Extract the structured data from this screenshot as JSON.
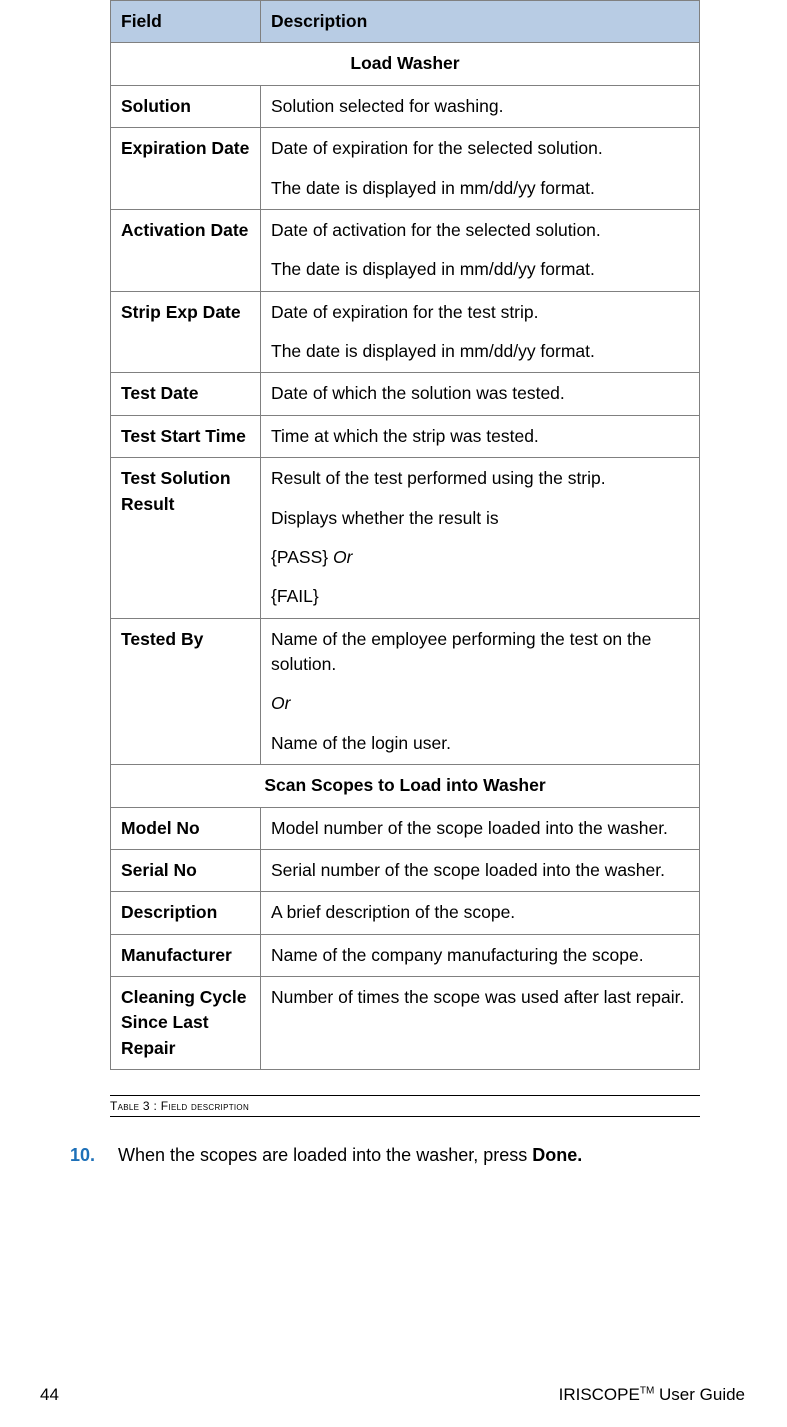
{
  "table": {
    "headers": {
      "field": "Field",
      "description": "Description"
    },
    "section1": "Load Washer",
    "rows1": [
      {
        "field": "Solution",
        "desc": [
          "Solution selected for washing."
        ]
      },
      {
        "field": "Expiration Date",
        "desc": [
          "Date of expiration for the selected solution.",
          "The date is displayed in mm/dd/yy format."
        ]
      },
      {
        "field": "Activation Date",
        "desc": [
          "Date of activation for the selected solution.",
          "The date is displayed in mm/dd/yy format."
        ]
      },
      {
        "field": "Strip Exp Date",
        "desc": [
          "Date of expiration for the test strip.",
          "The date is displayed in mm/dd/yy format."
        ]
      },
      {
        "field": "Test Date",
        "desc": [
          "Date of which  the solution was tested."
        ]
      },
      {
        "field": "Test Start Time",
        "desc": [
          "Time at which the strip was tested."
        ]
      },
      {
        "field": "Test Solution Result",
        "desc_html": "test_solution_result"
      },
      {
        "field": "Tested By",
        "desc_html": "tested_by"
      }
    ],
    "section2": "Scan Scopes to Load into Washer",
    "rows2": [
      {
        "field": "Model No",
        "desc": [
          "Model number of the scope loaded into the washer."
        ]
      },
      {
        "field": "Serial No",
        "desc": [
          "Serial number of the scope loaded into the washer."
        ]
      },
      {
        "field": "Description",
        "desc": [
          "A brief description of the scope."
        ]
      },
      {
        "field": "Manufacturer",
        "desc": [
          "Name of the company manufacturing the scope."
        ]
      },
      {
        "field": "Cleaning Cycle Since Last Repair",
        "desc": [
          "Number of times the scope was used after last repair."
        ]
      }
    ],
    "special": {
      "test_solution_result": {
        "p1": "Result of the test performed using the strip.",
        "p2": "Displays whether the result is",
        "p3_pre": "{PASS} ",
        "p3_it": "Or",
        "p4": "{FAIL}"
      },
      "tested_by": {
        "p1": "Name of the employee performing the test on the solution.",
        "p2_it": "Or",
        "p3": "Name of the login user."
      }
    }
  },
  "caption": "Table 3 : Field description",
  "step": {
    "num": "10.",
    "text_pre": "When the scopes are loaded into the washer, press ",
    "text_bold": "Done."
  },
  "footer": {
    "page": "44",
    "product": "IRISCOPE",
    "tm": "TM",
    "suffix": " User Guide"
  }
}
